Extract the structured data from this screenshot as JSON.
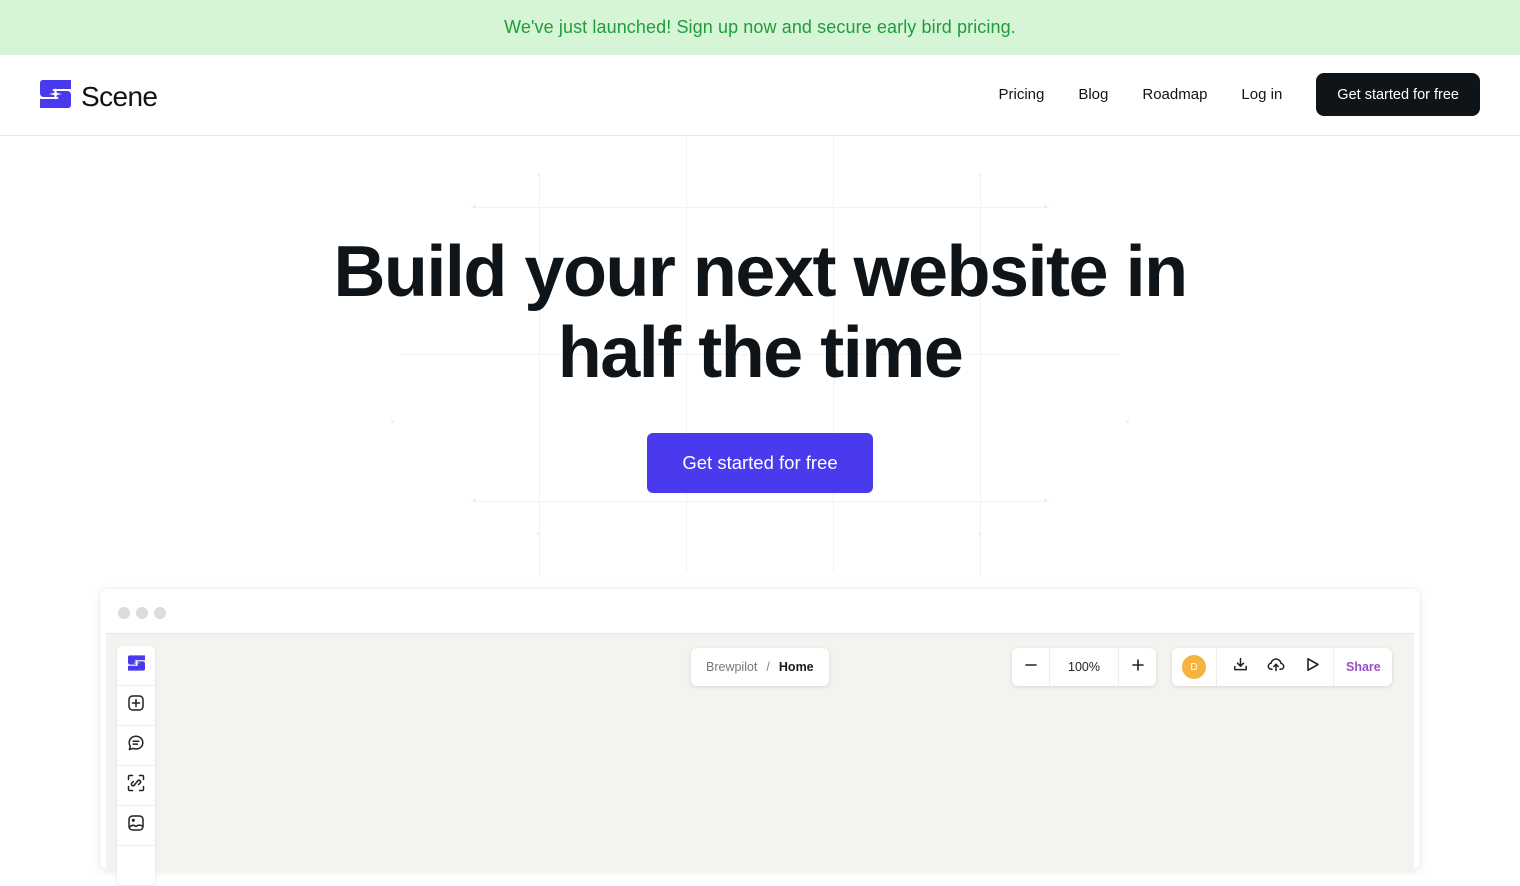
{
  "banner": {
    "text": "We've just launched! Sign up now and secure early bird pricing."
  },
  "nav": {
    "brand": "Scene",
    "links": [
      {
        "label": "Pricing"
      },
      {
        "label": "Blog"
      },
      {
        "label": "Roadmap"
      },
      {
        "label": "Log in"
      }
    ],
    "cta_label": "Get started for free"
  },
  "hero": {
    "title_line1": "Build your next website in",
    "title_line2": "half the time",
    "cta_label": "Get started for free"
  },
  "app_preview": {
    "toolbar_tools": [
      {
        "icon": "scene-logo-icon"
      },
      {
        "icon": "add-square-icon"
      },
      {
        "icon": "comment-icon"
      },
      {
        "icon": "link-scan-icon"
      },
      {
        "icon": "image-icon"
      }
    ],
    "breadcrumb": {
      "parent": "Brewpilot",
      "separator": "/",
      "current": "Home"
    },
    "zoom": {
      "value": "100%"
    },
    "user": {
      "avatar_initial": "D"
    },
    "actions": [
      {
        "icon": "download-icon"
      },
      {
        "icon": "cloud-upload-icon"
      },
      {
        "icon": "play-icon"
      }
    ],
    "share_label": "Share"
  },
  "colors": {
    "brand": "#4a3aee",
    "banner_bg": "#d6f5d6",
    "banner_text": "#1f9d3a",
    "dark": "#0f1419",
    "share": "#9b4fc7",
    "avatar": "#f5b43f"
  }
}
